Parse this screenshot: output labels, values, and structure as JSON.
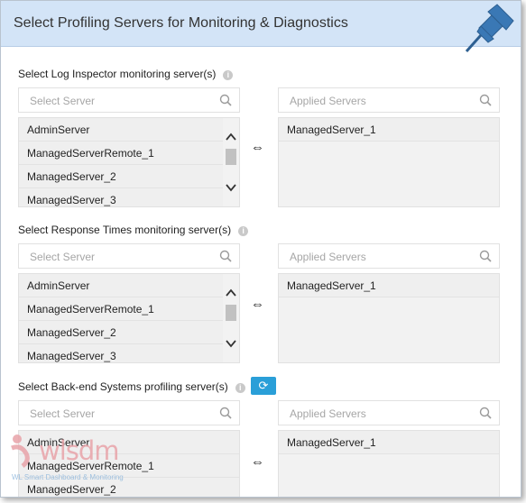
{
  "dialog": {
    "title": "Select Profiling Servers for Monitoring & Diagnostics",
    "info_glyph": "i",
    "refresh_glyph": "⟳",
    "transfer_glyph": "⇔"
  },
  "sections": [
    {
      "label": "Select Log Inspector monitoring server(s)",
      "search_placeholder": "Select Server",
      "applied_placeholder": "Applied Servers",
      "available": [
        "AdminServer",
        "ManagedServerRemote_1",
        "ManagedServer_2",
        "ManagedServer_3"
      ],
      "applied": [
        "ManagedServer_1"
      ],
      "has_refresh": false
    },
    {
      "label": "Select Response Times monitoring server(s)",
      "search_placeholder": "Select Server",
      "applied_placeholder": "Applied Servers",
      "available": [
        "AdminServer",
        "ManagedServerRemote_1",
        "ManagedServer_2",
        "ManagedServer_3"
      ],
      "applied": [
        "ManagedServer_1"
      ],
      "has_refresh": false
    },
    {
      "label": "Select Back-end Systems profiling server(s)",
      "search_placeholder": "Select Server",
      "applied_placeholder": "Applied Servers",
      "available": [
        "AdminServer",
        "ManagedServerRemote_1",
        "ManagedServer_2"
      ],
      "applied": [
        "ManagedServer_1"
      ],
      "has_refresh": true
    }
  ],
  "watermark": {
    "brand": "wlsdm",
    "tagline": "WL Smart Dashboard & Monitoring"
  },
  "colors": {
    "header_bg": "#d3e4f7",
    "accent": "#2a9fd8",
    "pin": "#3a78b5"
  },
  "icons": {
    "pin": "pushpin-icon",
    "search": "search-icon",
    "info": "info-icon",
    "refresh": "refresh-icon",
    "transfer": "double-arrow-icon",
    "scroll_up": "chevron-up-icon",
    "scroll_down": "chevron-down-icon"
  }
}
